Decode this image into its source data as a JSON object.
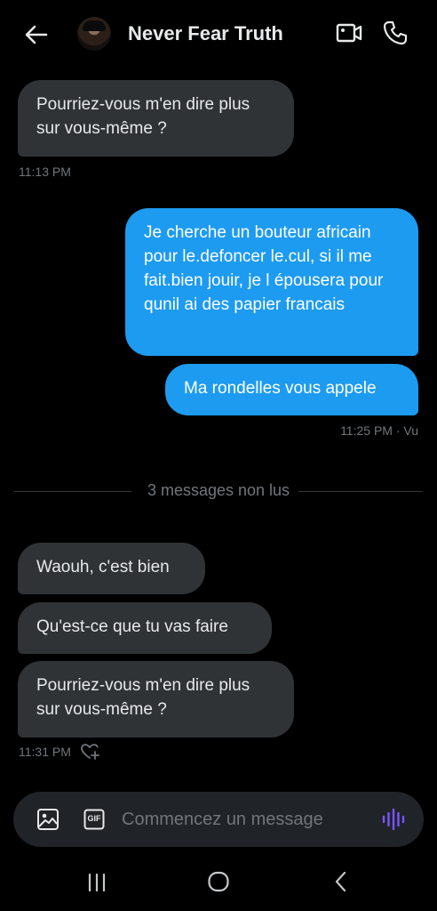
{
  "header": {
    "title": "Never Fear Truth",
    "back_icon": "arrow-left-icon",
    "video_icon": "video-camera-icon",
    "call_icon": "phone-icon"
  },
  "messages": [
    {
      "direction": "in",
      "text": "Pourriez-vous m'en dire plus sur vous-même ?"
    },
    {
      "direction": "out",
      "text": "Je cherche un bouteur africain pour le.defoncer le.cul, si il me fait.bien jouir, je l épousera pour qunil ai des papier francais"
    },
    {
      "direction": "out",
      "text": "Ma rondelles vous appele"
    },
    {
      "direction": "in",
      "text": "Waouh, c'est bien"
    },
    {
      "direction": "in",
      "text": "Qu'est-ce que tu vas faire"
    },
    {
      "direction": "in",
      "text": "Pourriez-vous m'en dire plus sur vous-même ?"
    }
  ],
  "timestamps": {
    "first": "11:13 PM",
    "second": "11:25 PM · Vu",
    "third": "11:31 PM"
  },
  "divider": {
    "label": "3 messages non lus"
  },
  "composer": {
    "placeholder": "Commencez un message",
    "value": "",
    "gif_label": "GIF"
  },
  "colors": {
    "background": "#000000",
    "incoming_bubble": "#2f3336",
    "outgoing_bubble": "#1d9bf0",
    "muted_text": "#71767b",
    "voice_accent": "#7856ff"
  }
}
